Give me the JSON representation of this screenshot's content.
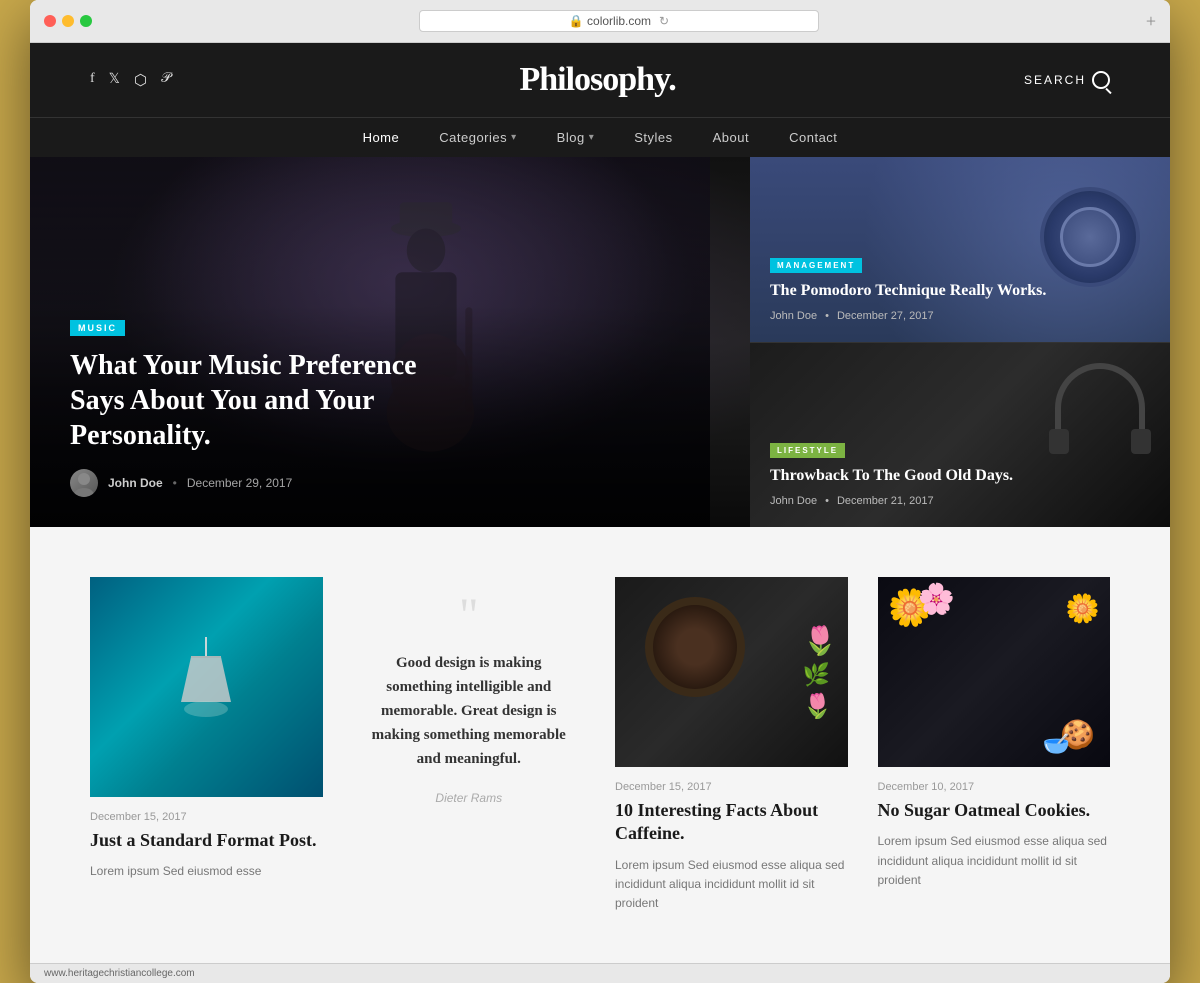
{
  "browser": {
    "url": "colorlib.com",
    "plus_label": "+"
  },
  "site": {
    "title": "Philosophy.",
    "social_icons": [
      "f",
      "𝕏",
      "◻",
      "⊕"
    ],
    "search_label": "SEARCH"
  },
  "nav": {
    "items": [
      {
        "label": "Home",
        "active": true,
        "has_dropdown": false
      },
      {
        "label": "Categories",
        "active": false,
        "has_dropdown": true
      },
      {
        "label": "Blog",
        "active": false,
        "has_dropdown": true
      },
      {
        "label": "Styles",
        "active": false,
        "has_dropdown": false
      },
      {
        "label": "About",
        "active": false,
        "has_dropdown": false
      },
      {
        "label": "Contact",
        "active": false,
        "has_dropdown": false
      }
    ]
  },
  "hero": {
    "category": "MUSIC",
    "title": "What Your Music Preference Says About You and Your Personality.",
    "author": "John Doe",
    "date": "December 29, 2017"
  },
  "side_articles": [
    {
      "category": "MANAGEMENT",
      "category_class": "management",
      "title": "The Pomodoro Technique Really Works.",
      "author": "John Doe",
      "date": "December 27, 2017"
    },
    {
      "category": "LIFESTYLE",
      "category_class": "lifestyle",
      "title": "Throwback To The Good Old Days.",
      "author": "John Doe",
      "date": "December 21, 2017"
    }
  ],
  "posts": [
    {
      "type": "image-post",
      "date": "December 15, 2017",
      "title": "Just a Standard Format Post.",
      "excerpt": "Lorem ipsum Sed eiusmod esse",
      "image_type": "lamp"
    },
    {
      "type": "quote",
      "text": "Good design is making something intelligible and memorable. Great design is making something memorable and meaningful.",
      "author": "Dieter Rams"
    },
    {
      "type": "image-post",
      "date": "December 15, 2017",
      "title": "10 Interesting Facts About Caffeine.",
      "excerpt": "Lorem ipsum Sed eiusmod esse aliqua sed incididunt aliqua incididunt mollit id sit proident",
      "image_type": "coffee"
    },
    {
      "type": "image-post",
      "date": "December 10, 2017",
      "title": "No Sugar Oatmeal Cookies.",
      "excerpt": "Lorem ipsum Sed eiusmod esse aliqua sed incididunt aliqua incididunt mollit id sit proident",
      "image_type": "flowers"
    }
  ],
  "status_bar": {
    "url": "www.heritagechristiancollege.com"
  }
}
